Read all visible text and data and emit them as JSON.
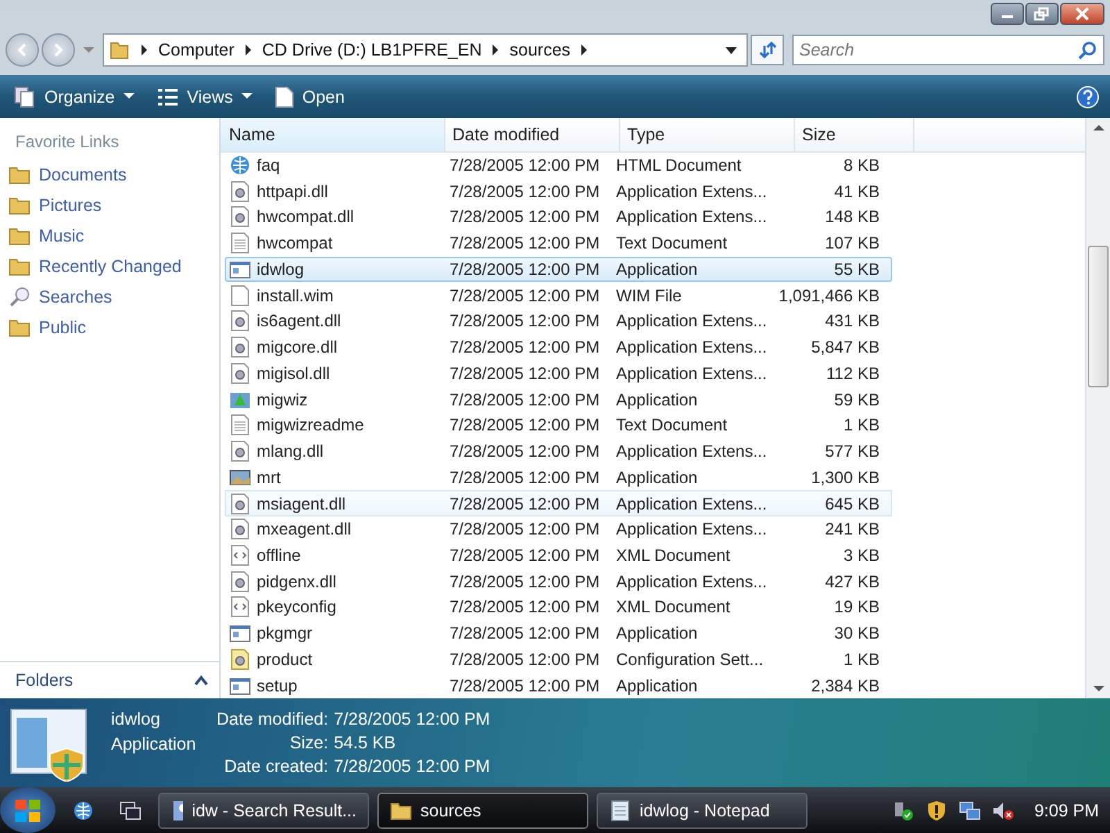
{
  "address": {
    "crumbs": [
      "Computer",
      "CD Drive (D:) LB1PFRE_EN",
      "sources"
    ]
  },
  "search": {
    "placeholder": "Search"
  },
  "toolbar": [
    {
      "label": "Organize",
      "kind": "organize"
    },
    {
      "label": "Views",
      "kind": "views"
    },
    {
      "label": "Open",
      "kind": "open"
    }
  ],
  "sidebar": {
    "title": "Favorite Links",
    "items": [
      {
        "label": "Documents",
        "kind": "folder"
      },
      {
        "label": "Pictures",
        "kind": "folder"
      },
      {
        "label": "Music",
        "kind": "folder"
      },
      {
        "label": "Recently Changed",
        "kind": "folder"
      },
      {
        "label": "Searches",
        "kind": "search"
      },
      {
        "label": "Public",
        "kind": "folder"
      }
    ],
    "folders": "Folders"
  },
  "table": {
    "columns": [
      "Name",
      "Date modified",
      "Type",
      "Size"
    ],
    "rows": [
      {
        "name": "faq",
        "date": "7/28/2005 12:00 PM",
        "type": "HTML Document",
        "size": "8 KB",
        "kind": "web",
        "selected": false,
        "hover": false
      },
      {
        "name": "httpapi.dll",
        "date": "7/28/2005 12:00 PM",
        "type": "Application Extens...",
        "size": "41 KB",
        "kind": "dll",
        "selected": false,
        "hover": false
      },
      {
        "name": "hwcompat.dll",
        "date": "7/28/2005 12:00 PM",
        "type": "Application Extens...",
        "size": "148 KB",
        "kind": "dll",
        "selected": false,
        "hover": false
      },
      {
        "name": "hwcompat",
        "date": "7/28/2005 12:00 PM",
        "type": "Text Document",
        "size": "107 KB",
        "kind": "text",
        "selected": false,
        "hover": false
      },
      {
        "name": "idwlog",
        "date": "7/28/2005 12:00 PM",
        "type": "Application",
        "size": "55 KB",
        "kind": "app",
        "selected": true,
        "hover": false
      },
      {
        "name": "install.wim",
        "date": "7/28/2005 12:00 PM",
        "type": "WIM File",
        "size": "1,091,466 KB",
        "kind": "blank",
        "selected": false,
        "hover": false
      },
      {
        "name": "is6agent.dll",
        "date": "7/28/2005 12:00 PM",
        "type": "Application Extens...",
        "size": "431 KB",
        "kind": "dll",
        "selected": false,
        "hover": false
      },
      {
        "name": "migcore.dll",
        "date": "7/28/2005 12:00 PM",
        "type": "Application Extens...",
        "size": "5,847 KB",
        "kind": "dll",
        "selected": false,
        "hover": false
      },
      {
        "name": "migisol.dll",
        "date": "7/28/2005 12:00 PM",
        "type": "Application Extens...",
        "size": "112 KB",
        "kind": "dll",
        "selected": false,
        "hover": false
      },
      {
        "name": "migwiz",
        "date": "7/28/2005 12:00 PM",
        "type": "Application",
        "size": "59 KB",
        "kind": "wizard",
        "selected": false,
        "hover": false
      },
      {
        "name": "migwizreadme",
        "date": "7/28/2005 12:00 PM",
        "type": "Text Document",
        "size": "1 KB",
        "kind": "text",
        "selected": false,
        "hover": false
      },
      {
        "name": "mlang.dll",
        "date": "7/28/2005 12:00 PM",
        "type": "Application Extens...",
        "size": "577 KB",
        "kind": "dll",
        "selected": false,
        "hover": false
      },
      {
        "name": "mrt",
        "date": "7/28/2005 12:00 PM",
        "type": "Application",
        "size": "1,300 KB",
        "kind": "picture",
        "selected": false,
        "hover": false
      },
      {
        "name": "msiagent.dll",
        "date": "7/28/2005 12:00 PM",
        "type": "Application Extens...",
        "size": "645 KB",
        "kind": "dll",
        "selected": false,
        "hover": true
      },
      {
        "name": "mxeagent.dll",
        "date": "7/28/2005 12:00 PM",
        "type": "Application Extens...",
        "size": "241 KB",
        "kind": "dll",
        "selected": false,
        "hover": false
      },
      {
        "name": "offline",
        "date": "7/28/2005 12:00 PM",
        "type": "XML Document",
        "size": "3 KB",
        "kind": "xml",
        "selected": false,
        "hover": false
      },
      {
        "name": "pidgenx.dll",
        "date": "7/28/2005 12:00 PM",
        "type": "Application Extens...",
        "size": "427 KB",
        "kind": "dll",
        "selected": false,
        "hover": false
      },
      {
        "name": "pkeyconfig",
        "date": "7/28/2005 12:00 PM",
        "type": "XML Document",
        "size": "19 KB",
        "kind": "xml",
        "selected": false,
        "hover": false
      },
      {
        "name": "pkgmgr",
        "date": "7/28/2005 12:00 PM",
        "type": "Application",
        "size": "30 KB",
        "kind": "app",
        "selected": false,
        "hover": false
      },
      {
        "name": "product",
        "date": "7/28/2005 12:00 PM",
        "type": "Configuration Sett...",
        "size": "1 KB",
        "kind": "config",
        "selected": false,
        "hover": false
      },
      {
        "name": "setup",
        "date": "7/28/2005 12:00 PM",
        "type": "Application",
        "size": "2,384 KB",
        "kind": "app",
        "selected": false,
        "hover": false
      }
    ]
  },
  "details": {
    "name": "idwlog",
    "type": "Application",
    "fields": [
      {
        "label": "Date modified:",
        "value": "7/28/2005 12:00 PM"
      },
      {
        "label": "Size:",
        "value": "54.5 KB"
      },
      {
        "label": "Date created:",
        "value": "7/28/2005 12:00 PM"
      }
    ]
  },
  "taskbar": {
    "buttons": [
      {
        "label": "idw - Search Result...",
        "kind": "search",
        "selected": false
      },
      {
        "label": "sources",
        "kind": "folder",
        "selected": true
      },
      {
        "label": "idwlog - Notepad",
        "kind": "notepad",
        "selected": false
      }
    ],
    "clock": "9:09 PM"
  }
}
